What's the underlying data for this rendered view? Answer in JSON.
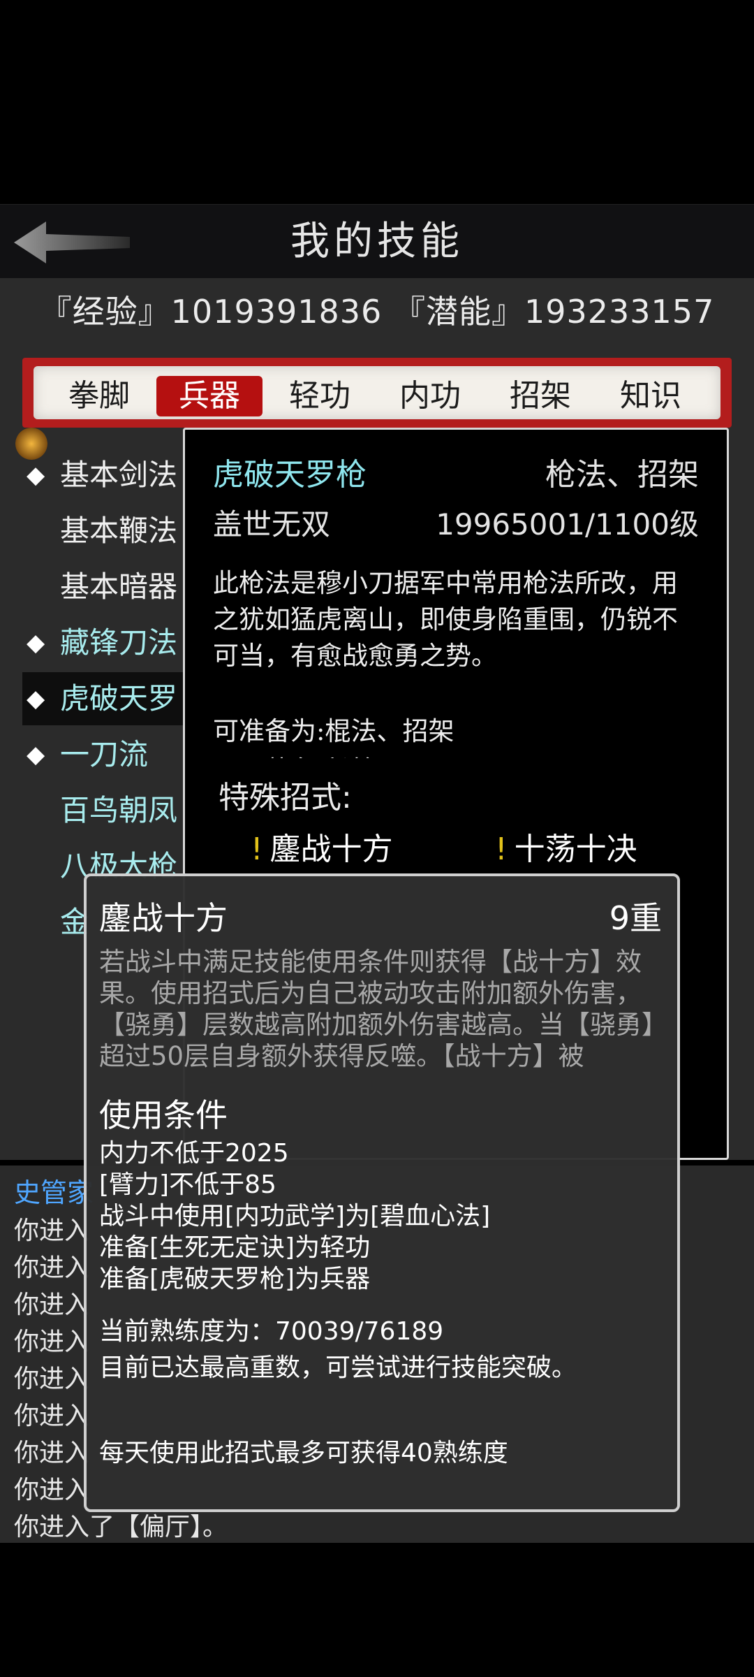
{
  "header": {
    "title": "我的技能",
    "back_icon": "back-arrow-icon"
  },
  "stats": {
    "text": "『经验』1019391836 『潜能』193233157"
  },
  "tabs": [
    {
      "label": "拳脚",
      "active": false
    },
    {
      "label": "兵器",
      "active": true
    },
    {
      "label": "轻功",
      "active": false
    },
    {
      "label": "内功",
      "active": false
    },
    {
      "label": "招架",
      "active": false
    },
    {
      "label": "知识",
      "active": false
    }
  ],
  "skills": [
    {
      "label": "基本剑法",
      "diamond": true,
      "color": "#ffffff"
    },
    {
      "label": "基本鞭法",
      "diamond": false,
      "color": "#ffffff"
    },
    {
      "label": "基本暗器",
      "diamond": false,
      "color": "#ffffff"
    },
    {
      "label": "藏锋刀法",
      "diamond": true,
      "color": "#a8ecee"
    },
    {
      "label": "虎破天罗",
      "diamond": true,
      "color": "#a8ecee",
      "selected": true
    },
    {
      "label": "一刀流",
      "diamond": true,
      "color": "#a8ecee"
    },
    {
      "label": "百鸟朝凤",
      "diamond": false,
      "color": "#a8ecee"
    },
    {
      "label": "八极大枪",
      "diamond": false,
      "color": "#a8ecee"
    },
    {
      "label": "金",
      "diamond": false,
      "color": "#a8ecee"
    }
  ],
  "detail": {
    "name": "虎破天罗枪",
    "type": "枪法、招架",
    "rank": "盖世无双",
    "level": "19965001/1100级",
    "description": "此枪法是穆小刀据军中常用枪法所改，用之犹如猛虎离山，即使身陷重围，仍锐不可当，有愈战愈勇之势。",
    "equip_lines": [
      "可准备为:棍法、招架",
      "需要装备:长枪"
    ],
    "special_title": "特殊招式:",
    "moves": [
      "鏖战十方",
      "十荡十决"
    ]
  },
  "tooltip": {
    "name": "鏖战十方",
    "grade": "9重",
    "description": "若战斗中满足技能使用条件则获得【战十方】效果。使用招式后为自己被动攻击附加额外伤害，【骁勇】层数越高附加额外伤害越高。当【骁勇】超过50层自身额外获得反噬。【战十方】被",
    "conditions_title": "使用条件",
    "conditions": [
      "内力不低于2025",
      "[臂力]不低于85",
      "战斗中使用[内功武学]为[碧血心法]",
      "准备[生死无定诀]为轻功",
      "准备[虎破天罗枪]为兵器"
    ],
    "proficiency": "当前熟练度为：70039/76189",
    "max_note": "目前已达最高重数，可尝试进行技能突破。",
    "daily_note": "每天使用此招式最多可获得40熟练度"
  },
  "chat": {
    "header": "史管家",
    "lines": [
      "你进入",
      "你进入",
      "你进入",
      "你进入",
      "你进入",
      "你进入",
      "你进入",
      "你进入"
    ],
    "last_line": "你进入了【偏厅】。"
  },
  "colors": {
    "accent_red": "#b51010",
    "skill_cyan": "#8fe6ee",
    "chat_blue": "#4fa6ff",
    "move_mark": "#e2c21a"
  }
}
